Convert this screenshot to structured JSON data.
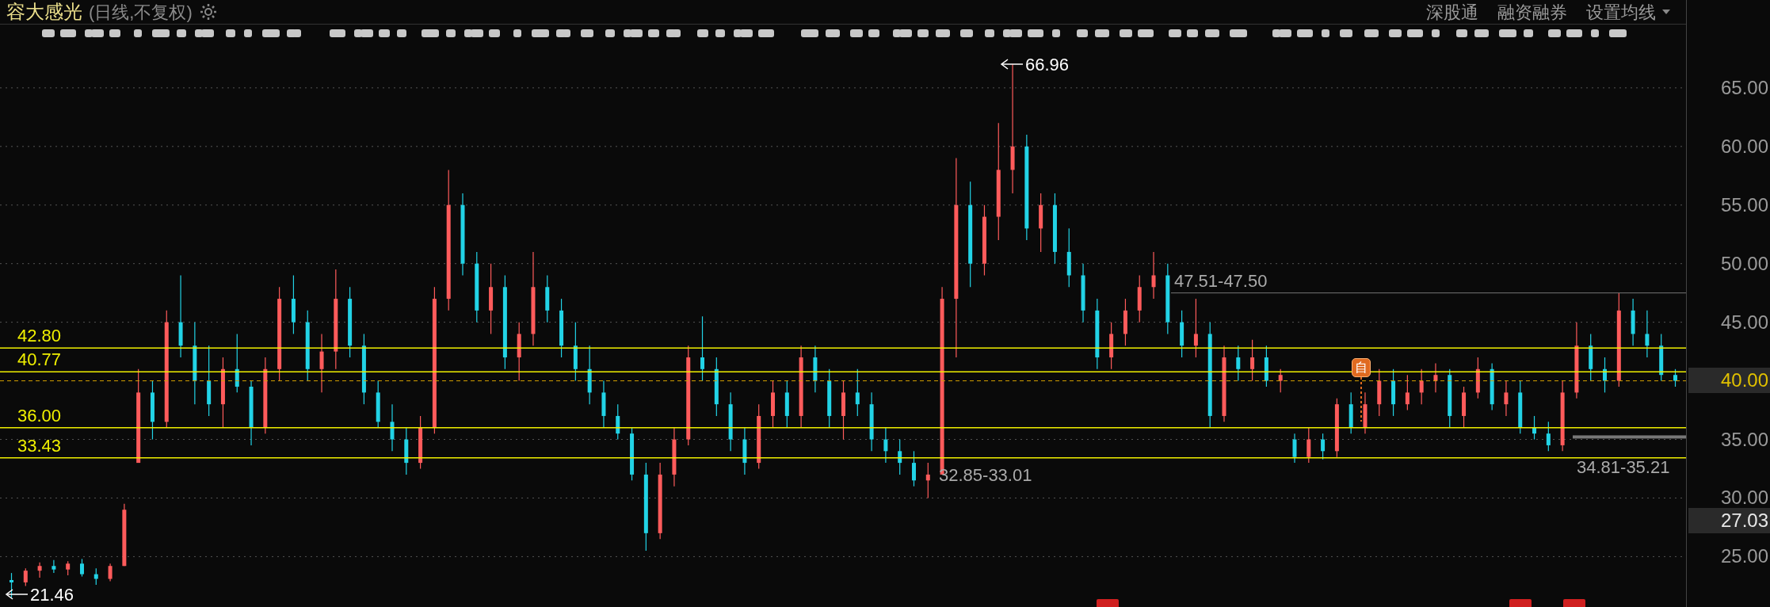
{
  "stock": {
    "name": "容大感光",
    "period": "(日线,不复权)"
  },
  "header_links": [
    "深股通",
    "融资融券",
    "设置均线"
  ],
  "price_axis": {
    "current_tag": "40.00",
    "cursor_tag": "27.03"
  },
  "event_badge": "自",
  "level_lines": [
    {
      "label": "42.80"
    },
    {
      "label": "40.77"
    },
    {
      "label": "36.00"
    },
    {
      "label": "33.43"
    }
  ],
  "range_marks": [
    {
      "label": "47.51-47.50"
    },
    {
      "label": "34.81-35.21"
    }
  ],
  "chart_data": {
    "type": "candlestick",
    "ylim": [
      20.7,
      68.71
    ],
    "grid": true,
    "yticks": [
      {
        "value": 65,
        "label": "65.00"
      },
      {
        "value": 60,
        "label": "60.00"
      },
      {
        "value": 55,
        "label": "55.00"
      },
      {
        "value": 50,
        "label": "50.00"
      },
      {
        "value": 45,
        "label": "45.00"
      },
      {
        "value": 35,
        "label": "35.00"
      },
      {
        "value": 30,
        "label": "30.00"
      },
      {
        "value": 25,
        "label": "25.00"
      }
    ],
    "annotations": [
      {
        "text": "66.96"
      },
      {
        "text": "21.46"
      },
      {
        "text": "32.85-33.01"
      }
    ],
    "ohlc": [
      [
        23,
        23.6,
        21.5,
        22.8
      ],
      [
        22.8,
        24,
        22.5,
        23.8
      ],
      [
        23.8,
        24.5,
        23.2,
        24.2
      ],
      [
        24.2,
        24.7,
        23.6,
        23.9
      ],
      [
        23.9,
        24.6,
        23.4,
        24.4
      ],
      [
        24.4,
        24.8,
        23.3,
        23.5
      ],
      [
        23.5,
        24,
        22.6,
        23.1
      ],
      [
        23.1,
        24.4,
        22.9,
        24.2
      ],
      [
        24.2,
        29.5,
        24.2,
        29
      ],
      [
        33,
        41,
        33,
        39
      ],
      [
        39,
        40,
        35,
        36.5
      ],
      [
        36.5,
        46,
        36,
        45
      ],
      [
        45,
        49,
        42,
        43
      ],
      [
        43,
        45,
        38,
        40
      ],
      [
        40,
        43,
        37,
        38
      ],
      [
        38,
        42,
        36,
        41
      ],
      [
        41,
        44,
        39,
        39.5
      ],
      [
        39.5,
        40,
        34.5,
        36
      ],
      [
        36,
        42,
        35.5,
        41
      ],
      [
        41,
        48,
        40,
        47
      ],
      [
        47,
        49,
        44,
        45
      ],
      [
        45,
        46,
        40,
        41
      ],
      [
        41,
        44,
        39,
        42.5
      ],
      [
        42.5,
        49.5,
        41,
        47
      ],
      [
        47,
        48,
        42,
        43
      ],
      [
        43,
        44,
        38,
        39
      ],
      [
        39,
        40,
        36,
        36.5
      ],
      [
        36.5,
        38,
        34,
        35
      ],
      [
        35,
        36,
        32,
        33
      ],
      [
        33,
        37,
        32.5,
        36
      ],
      [
        36,
        48,
        35.5,
        47
      ],
      [
        47,
        58,
        46,
        55
      ],
      [
        55,
        56,
        49,
        50
      ],
      [
        50,
        51,
        45,
        46
      ],
      [
        46,
        50,
        44,
        48
      ],
      [
        48,
        49,
        41,
        42
      ],
      [
        42,
        45,
        40,
        44
      ],
      [
        44,
        51,
        43,
        48
      ],
      [
        48,
        49,
        45,
        46
      ],
      [
        46,
        47,
        42,
        43
      ],
      [
        43,
        45,
        40,
        41
      ],
      [
        41,
        43,
        38,
        39
      ],
      [
        39,
        40,
        36,
        37
      ],
      [
        37,
        38,
        35,
        35.5
      ],
      [
        35.5,
        36,
        31.5,
        32
      ],
      [
        32,
        33,
        25.5,
        27
      ],
      [
        27,
        33,
        26.5,
        32
      ],
      [
        32,
        36,
        31,
        35
      ],
      [
        35,
        43,
        34.5,
        42
      ],
      [
        42,
        45.5,
        40,
        41
      ],
      [
        41,
        42,
        37,
        38
      ],
      [
        38,
        39,
        34,
        35
      ],
      [
        35,
        36,
        32,
        33
      ],
      [
        33,
        38,
        32.5,
        37
      ],
      [
        37,
        40,
        36,
        39
      ],
      [
        39,
        40,
        36,
        37
      ],
      [
        37,
        43,
        36,
        42
      ],
      [
        42,
        43,
        39,
        40
      ],
      [
        40,
        41,
        36,
        37
      ],
      [
        37,
        40,
        35,
        39
      ],
      [
        39,
        41,
        37,
        38
      ],
      [
        38,
        39,
        34,
        35
      ],
      [
        35,
        36,
        33,
        34
      ],
      [
        34,
        35,
        32,
        33
      ],
      [
        33,
        34,
        31,
        31.5
      ],
      [
        31.5,
        33,
        30,
        32
      ],
      [
        32,
        48,
        32,
        47
      ],
      [
        47,
        59,
        42,
        55
      ],
      [
        55,
        57,
        48,
        50
      ],
      [
        50,
        55,
        49,
        54
      ],
      [
        54,
        62,
        52,
        58
      ],
      [
        58,
        67,
        56,
        60
      ],
      [
        60,
        61,
        52,
        53
      ],
      [
        53,
        56,
        51,
        55
      ],
      [
        55,
        56,
        50,
        51
      ],
      [
        51,
        53,
        48,
        49
      ],
      [
        49,
        50,
        45,
        46
      ],
      [
        46,
        47,
        41,
        42
      ],
      [
        42,
        45,
        41,
        44
      ],
      [
        44,
        47,
        43,
        46
      ],
      [
        46,
        49,
        45,
        48
      ],
      [
        48,
        51,
        47,
        49
      ],
      [
        49,
        50,
        44,
        45
      ],
      [
        45,
        46,
        42,
        43
      ],
      [
        43,
        47,
        42,
        44
      ],
      [
        44,
        45,
        36,
        37
      ],
      [
        37,
        43,
        36.5,
        42
      ],
      [
        42,
        43,
        40,
        41
      ],
      [
        41,
        43.5,
        40,
        42
      ],
      [
        42,
        43,
        39.5,
        40
      ],
      [
        40,
        41,
        39,
        40.5
      ],
      [
        35,
        35.5,
        33,
        33.5
      ],
      [
        33.5,
        36,
        33,
        35
      ],
      [
        35,
        35.5,
        33.3,
        34
      ],
      [
        34,
        38.5,
        33.5,
        38
      ],
      [
        38,
        39,
        35.5,
        36
      ],
      [
        36,
        39,
        35.5,
        38
      ],
      [
        38,
        41,
        37,
        40
      ],
      [
        40,
        41,
        37,
        38
      ],
      [
        38,
        40.5,
        37.5,
        39
      ],
      [
        39,
        41,
        38,
        40
      ],
      [
        40,
        41.5,
        39,
        40.5
      ],
      [
        40.5,
        41,
        36,
        37
      ],
      [
        37,
        39.5,
        36,
        39
      ],
      [
        39,
        42,
        38.5,
        41
      ],
      [
        41,
        41.5,
        37.5,
        38
      ],
      [
        38,
        40,
        37,
        39
      ],
      [
        39,
        40,
        35.5,
        36
      ],
      [
        36,
        37,
        35,
        35.5
      ],
      [
        35.5,
        36.5,
        34,
        34.5
      ],
      [
        34.5,
        40,
        34,
        39
      ],
      [
        39,
        45,
        38.5,
        43
      ],
      [
        43,
        44,
        40,
        41
      ],
      [
        41,
        42,
        39,
        40
      ],
      [
        40,
        47.5,
        39.5,
        46
      ],
      [
        46,
        47,
        43,
        44
      ],
      [
        44,
        46,
        42,
        43
      ],
      [
        43,
        44,
        40,
        40.5
      ],
      [
        40.5,
        41,
        39.5,
        40
      ]
    ]
  }
}
